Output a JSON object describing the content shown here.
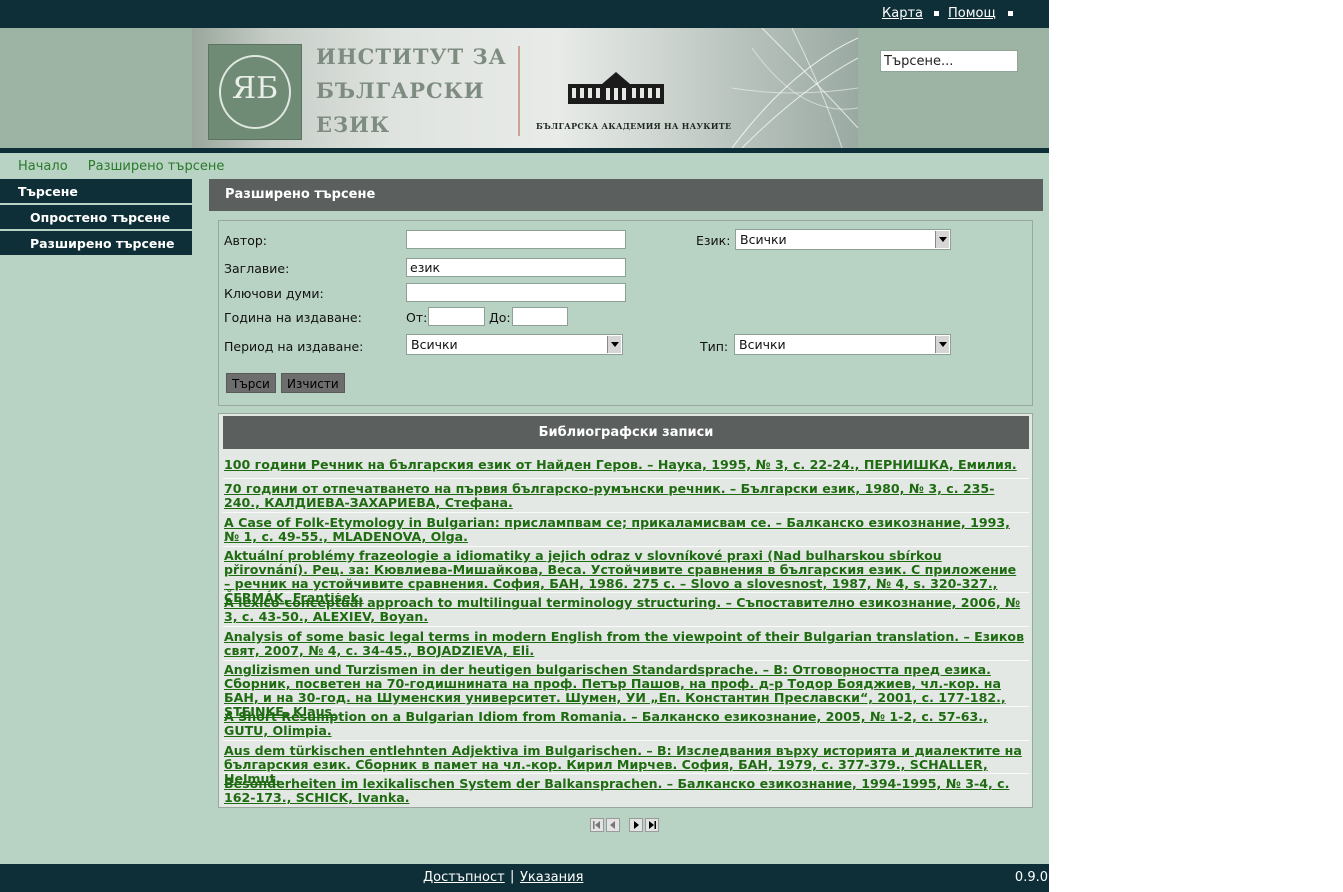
{
  "topbar": {
    "links": [
      "Карта",
      "Помощ"
    ]
  },
  "header": {
    "institute_lines": [
      "ИНСТИТУТ ЗА",
      "БЪЛГАРСКИ",
      "ЕЗИК"
    ],
    "academy": "БЪЛГАРСКА АКАДЕМИЯ НА НАУКИТЕ",
    "search_value": "Търсене..."
  },
  "breadcrumb": [
    "Начало",
    "Разширено търсене"
  ],
  "sidebar": {
    "items": [
      "Търсене",
      "Опростено търсене",
      "Разширено търсене"
    ]
  },
  "section": {
    "title": "Разширено търсене"
  },
  "form": {
    "author_label": "Автор:",
    "author_value": "",
    "title_label": "Заглавие:",
    "title_value": "език",
    "keywords_label": "Ключови думи:",
    "keywords_value": "",
    "year_label": "Година на издаване:",
    "from_label": "От:",
    "to_label": "До:",
    "period_label": "Период на издаване:",
    "period_value": "Всички",
    "language_label": "Език:",
    "language_value": "Всички",
    "type_label": "Тип:",
    "type_value": "Всички",
    "search_button": "Търси",
    "clear_button": "Изчисти"
  },
  "results": {
    "title": "Библиографски записи",
    "records": [
      "100 години Речник на българския език от Найден Геров. – Наука, 1995, № 3, с. 22-24., ПЕРНИШКА, Емилия.",
      "70 години от отпечатването на първия българско-румънски речник. – Български език, 1980, № 3, с. 235-240., КАЛДИЕВА-ЗАХАРИЕВА, Стефана.",
      "A Case of Folk-Etymology in Bulgarian: прислампвам се; прикаламисвам се. – Балканско езикознание, 1993, № 1, с. 49-55., MLADENOVA, Olga.",
      "Aktuální problémy frazeologie a idiomatiky a jejich odraz v slovníkové praxi (Nad bulharskou sbírkou přirovnání). Рец. за: Кювлиева-Мишайкова, Веса. Устойчивите сравнения в българския език. С приложение – речник на устойчивите сравнения. София, БАН, 1986. 275 с. – Slovo a slovesnost, 1987, № 4, s. 320-327., ČERMÁK, František.",
      "A lexico-conceptual approach to multilingual terminology structuring. – Съпоставително езикознание, 2006, № 3, с. 43-50., ALEXIEV, Boyan.",
      "Analysis of some basic legal terms in modern English from the viewpoint of their Bulgarian translation. – Езиков свят, 2007, № 4, с. 34-45., BOJADZIEVA, Eli.",
      "Anglizismen und Turzismen in der heutigen bulgarischen Standardsprache. – В: Отговорността пред езика. Сборник, посветен на 70-годишнината на проф. Петър Пашов, на проф. д-р Тодор Бояджиев, чл.-кор. на БАН, и на 30-год. на Шуменския университет. Шумен, УИ „Еп. Константин Преславски“, 2001, с. 177-182., STEINKE, Klaus.",
      "A Short Resumption on a Bulgarian Idiom from Romania. – Балканско езикознание, 2005, № 1-2, с. 57-63., GUTU, Olimpia.",
      "Aus dem türkischen entlehnten Adjektiva im Bulgarischen. – В: Изследвания върху историята и диалектите на българския език. Сборник в памет на чл.-кор. Кирил Мирчев. София, БАН, 1979, с. 377-379., SCHALLER, Helmut.",
      "Besonderheiten im lexikalischen System der Balkansprachen. – Балканско езикознание, 1994-1995, № 3-4, с. 162-173., SCHICK, Ivanka."
    ]
  },
  "pager": {
    "icons": [
      "first-page-icon",
      "prev-page-icon",
      "next-page-icon",
      "last-page-icon"
    ]
  },
  "footer": {
    "links": [
      "Достъпност",
      "Указания"
    ],
    "separator": "|",
    "version": "0.9.0"
  }
}
